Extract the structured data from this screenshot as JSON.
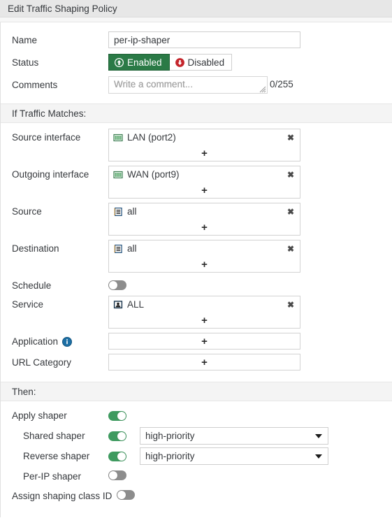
{
  "window": {
    "title": "Edit Traffic Shaping Policy"
  },
  "general": {
    "name_label": "Name",
    "name_value": "per-ip-shaper",
    "status_label": "Status",
    "status_enabled_label": "Enabled",
    "status_disabled_label": "Disabled",
    "status_selected": "Enabled",
    "comments_label": "Comments",
    "comments_value": "",
    "comments_placeholder": "Write a comment...",
    "comments_counter": "0/255"
  },
  "match_section": {
    "heading": "If Traffic Matches:",
    "add_label": "+",
    "remove_label": "✖",
    "fields": [
      {
        "label": "Source interface",
        "icon": "network-interface-icon",
        "items": [
          {
            "text": "LAN (port2)",
            "icon": "network-interface-icon"
          }
        ]
      },
      {
        "label": "Outgoing interface",
        "icon": "network-interface-icon",
        "items": [
          {
            "text": "WAN (port9)",
            "icon": "network-interface-icon"
          }
        ]
      },
      {
        "label": "Source",
        "icon": "address-object-icon",
        "items": [
          {
            "text": "all",
            "icon": "address-object-icon"
          }
        ]
      },
      {
        "label": "Destination",
        "icon": "address-object-icon",
        "items": [
          {
            "text": "all",
            "icon": "address-object-icon"
          }
        ]
      }
    ],
    "schedule": {
      "label": "Schedule",
      "enabled": false
    },
    "service": {
      "label": "Service",
      "items": [
        {
          "text": "ALL",
          "icon": "service-object-icon"
        }
      ]
    },
    "application": {
      "label": "Application",
      "info_icon": "info-icon",
      "items": []
    },
    "url_category": {
      "label": "URL Category",
      "items": []
    }
  },
  "then_section": {
    "heading": "Then:",
    "apply_shaper": {
      "label": "Apply shaper",
      "enabled": true
    },
    "shared_shaper": {
      "label": "Shared shaper",
      "enabled": true,
      "value": "high-priority",
      "options": [
        "high-priority"
      ]
    },
    "reverse_shaper": {
      "label": "Reverse shaper",
      "enabled": true,
      "value": "high-priority",
      "options": [
        "high-priority"
      ]
    },
    "per_ip_shaper": {
      "label": "Per-IP shaper",
      "enabled": false
    },
    "assign_class_id": {
      "label": "Assign shaping class ID",
      "enabled": false
    }
  },
  "colors": {
    "accent_green": "#2a7a46",
    "toggle_on": "#3e9a5f",
    "toggle_off": "#8d8d8d",
    "status_red": "#c4242b",
    "info_blue": "#1d6fa5",
    "band_bg": "#f4f4f4",
    "titlebar_bg": "#e7e7e7"
  }
}
